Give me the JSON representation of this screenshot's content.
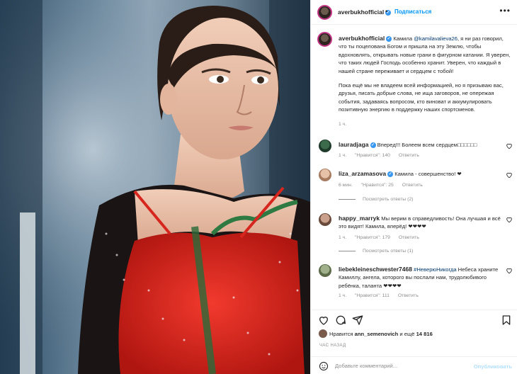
{
  "post": {
    "username": "averbukhofficial",
    "follow_label": "Подписаться",
    "separator": "•",
    "more_icon": "more-horizontal-icon"
  },
  "caption": {
    "username": "averbukhofficial",
    "part1": "Камила",
    "mention": "@kamilavalieva26",
    "part2": ", я ни раз говорил, что ты поцелована Богом и пришла на эту Землю, чтобы вдохновлять, открывать новые грани в фигурном катании. Я уверен, что таких людей Господь особенно хранит. Уверен, что каждый в нашей стране переживает и сердцем с тобой!",
    "paragraph2": "Пока ещё мы не владеем всей информацией, но я призываю вас, друзья, писать добрые слова, не ища заговоров, не опережая события, задаваясь вопросом, кто виноват и аккумулировать позитивную энергию в поддержку наших спортсменов.",
    "time": "1 ч."
  },
  "comments": [
    {
      "username": "lauradjaga",
      "verified": true,
      "text": "Вперед!!! Болеем всем сердцем□□□□□□",
      "time": "1 ч.",
      "likes": "\"Нравится\": 140",
      "reply": "Ответить",
      "view_replies": ""
    },
    {
      "username": "liza_arzamasova",
      "verified": true,
      "text": "Камила - совершенство! ❤",
      "time": "6 мин.",
      "likes": "\"Нравится\": 25",
      "reply": "Ответить",
      "view_replies": "Посмотреть ответы (2)"
    },
    {
      "username": "happy_marryk",
      "verified": false,
      "text": "Мы верим в справедливость! Она лучшая и всё это видят! Камила, вперёд! ❤❤❤❤",
      "time": "1 ч.",
      "likes": "\"Нравится\": 179",
      "reply": "Ответить",
      "view_replies": "Посмотреть ответы (1)"
    },
    {
      "username": "liebekleineschwester7468",
      "verified": false,
      "hashtag": "#НеверюНикогда",
      "text": " Небеса храните Камиллу, ангела, которого вы послали нам, трудолюбивого ребёнка, таланта ❤❤❤❤",
      "time": "1 ч.",
      "likes": "\"Нравится\": 111",
      "reply": "Ответить",
      "view_replies": ""
    }
  ],
  "likes": {
    "prefix": "Нравится",
    "user": "ann_semenovich",
    "suffix": "и ещё",
    "count": "14 816"
  },
  "posted_ago": "ЧАС НАЗАД",
  "add_comment": {
    "placeholder": "Добавьте комментарий...",
    "publish_label": "Опубликовать"
  },
  "colors": {
    "accent": "#0095f6",
    "verified": "#3897f0",
    "muted": "#8e8e8e",
    "dress_red": "#d7261e"
  }
}
